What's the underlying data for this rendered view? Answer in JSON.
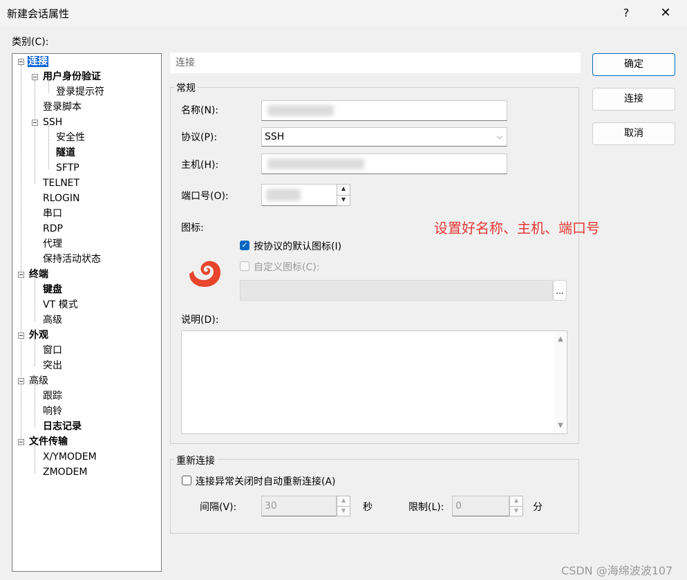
{
  "window": {
    "title": "新建会话属性",
    "help": "?",
    "close": "✕"
  },
  "category_label": "类别(C):",
  "tree": [
    {
      "label": "连接",
      "bold": true,
      "selected": true
    },
    {
      "label": "用户身份验证",
      "bold": true
    },
    {
      "label": "登录提示符"
    },
    {
      "label": "登录脚本"
    },
    {
      "label": "SSH"
    },
    {
      "label": "安全性"
    },
    {
      "label": "隧道",
      "bold": true
    },
    {
      "label": "SFTP"
    },
    {
      "label": "TELNET"
    },
    {
      "label": "RLOGIN"
    },
    {
      "label": "串口"
    },
    {
      "label": "RDP"
    },
    {
      "label": "代理"
    },
    {
      "label": "保持活动状态"
    },
    {
      "label": "终端",
      "bold": true
    },
    {
      "label": "键盘",
      "bold": true
    },
    {
      "label": "VT 模式"
    },
    {
      "label": "高级"
    },
    {
      "label": "外观",
      "bold": true
    },
    {
      "label": "窗口"
    },
    {
      "label": "突出"
    },
    {
      "label": "高级"
    },
    {
      "label": "跟踪"
    },
    {
      "label": "响铃"
    },
    {
      "label": "日志记录",
      "bold": true
    },
    {
      "label": "文件传输",
      "bold": true
    },
    {
      "label": "X/YMODEM"
    },
    {
      "label": "ZMODEM"
    }
  ],
  "breadcrumb": "连接",
  "general": {
    "legend": "常规",
    "name_label": "名称(N):",
    "protocol_label": "协议(P):",
    "protocol_value": "SSH",
    "host_label": "主机(H):",
    "port_label": "端口号(O):",
    "icon_label": "图标:",
    "default_icon_label": "按协议的默认图标(I)",
    "custom_icon_label": "自定义图标(C):",
    "browse": "...",
    "description_label": "说明(D):"
  },
  "reconnect": {
    "legend": "重新连接",
    "auto_label": "连接异常关闭时自动重新连接(A)",
    "interval_label": "间隔(V):",
    "interval_value": "30",
    "seconds": "秒",
    "limit_label": "限制(L):",
    "limit_value": "0",
    "minutes": "分"
  },
  "buttons": {
    "ok": "确定",
    "connect": "连接",
    "cancel": "取消"
  },
  "annotation": "设置好名称、主机、端口号",
  "watermark": "CSDN @海绵波波107",
  "colors": {
    "accent": "#0067c0",
    "annotation": "#e53935",
    "icon": "#e8452c"
  }
}
